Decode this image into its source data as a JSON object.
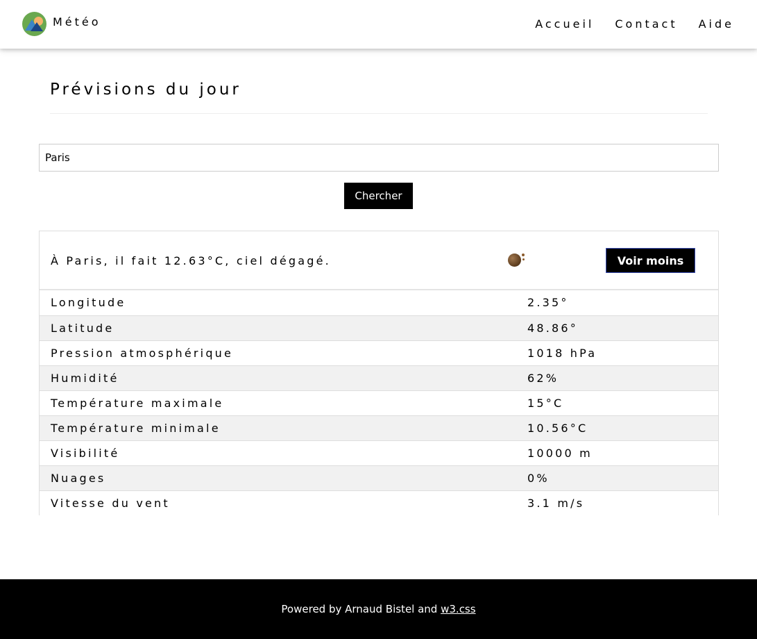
{
  "navbar": {
    "brand": "Météo",
    "logo_icon": "weather-logo-icon",
    "links": [
      "Accueil",
      "Contact",
      "Aide"
    ]
  },
  "main": {
    "title": "Prévisions du jour",
    "search": {
      "value": "Paris",
      "button_label": "Chercher"
    },
    "result": {
      "summary": "À Paris, il fait 12.63°C, ciel dégagé.",
      "weather_icon": "clear-sky-icon",
      "toggle_label": "Voir moins",
      "details": [
        {
          "label": "Longitude",
          "value": "2.35°"
        },
        {
          "label": "Latitude",
          "value": "48.86°"
        },
        {
          "label": "Pression atmosphérique",
          "value": "1018 hPa"
        },
        {
          "label": "Humidité",
          "value": "62%"
        },
        {
          "label": "Température maximale",
          "value": "15°C"
        },
        {
          "label": "Température minimale",
          "value": "10.56°C"
        },
        {
          "label": "Visibilité",
          "value": "10000 m"
        },
        {
          "label": "Nuages",
          "value": "0%"
        },
        {
          "label": "Vitesse du vent",
          "value": "3.1 m/s"
        }
      ]
    }
  },
  "footer": {
    "prefix": "Powered by Arnaud Bistel and ",
    "link_label": "w3.css"
  },
  "colors": {
    "button_bg": "#000000",
    "striped_row": "#f1f1f1",
    "footer_bg": "#000000"
  }
}
